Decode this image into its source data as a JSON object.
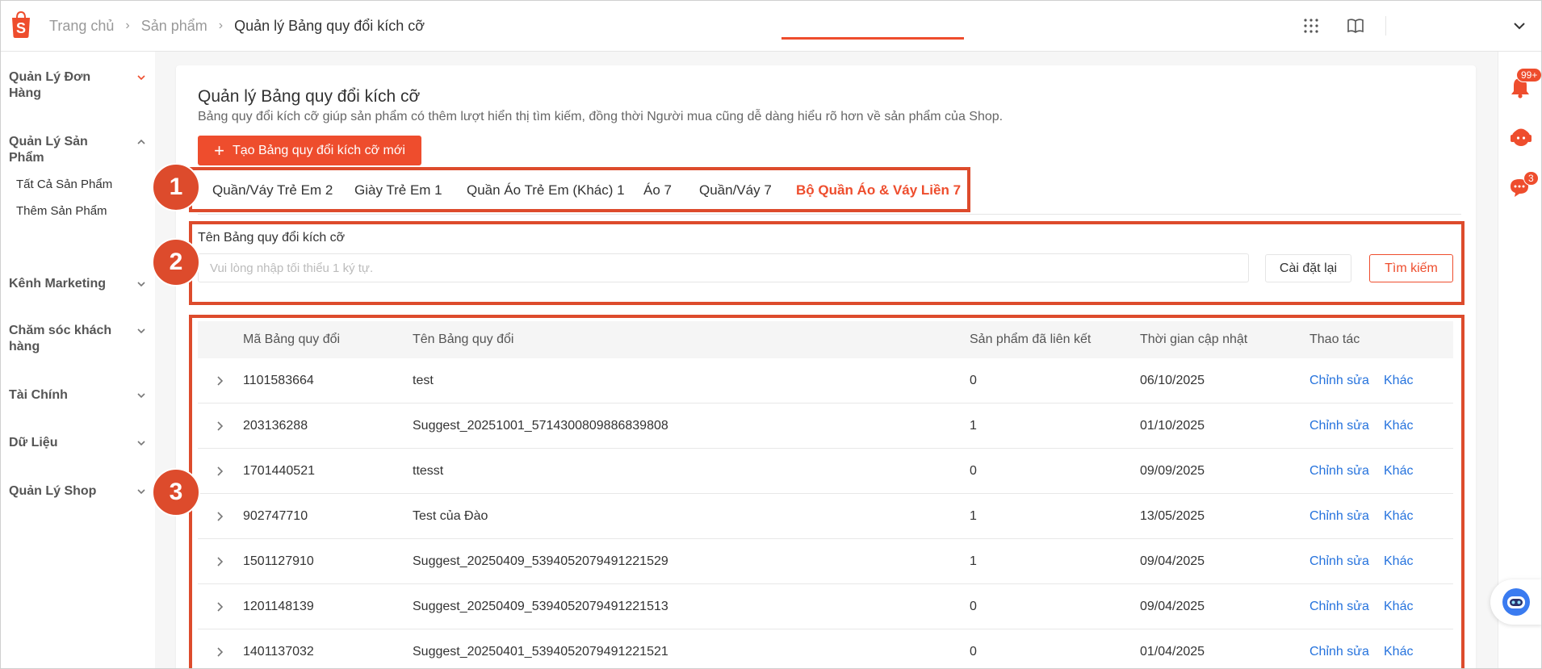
{
  "breadcrumb": {
    "home": "Trang chủ",
    "products": "Sản phẩm",
    "current": "Quản lý Bảng quy đổi kích cỡ"
  },
  "sidebar": {
    "groups": [
      {
        "label": "Quản Lý Đơn Hàng",
        "expanded": false
      },
      {
        "label": "Quản Lý Sản Phẩm",
        "expanded": true,
        "items": [
          "Tất Cả Sản Phẩm",
          "Thêm Sản Phẩm"
        ]
      },
      {
        "label": "Kênh Marketing",
        "expanded": false
      },
      {
        "label": "Chăm sóc khách hàng",
        "expanded": false
      },
      {
        "label": "Tài Chính",
        "expanded": false
      },
      {
        "label": "Dữ Liệu",
        "expanded": false
      },
      {
        "label": "Quản Lý Shop",
        "expanded": false
      }
    ]
  },
  "page": {
    "title": "Quản lý Bảng quy đổi kích cỡ",
    "subtitle": "Bảng quy đổi kích cỡ giúp sản phẩm có thêm lượt hiển thị tìm kiếm, đồng thời Người mua cũng dễ dàng hiểu rõ hơn về sản phẩm của Shop.",
    "create_button": "Tạo Bảng quy đổi kích cỡ mới"
  },
  "tabs": [
    {
      "label": "Quần/Váy Trẻ Em 2",
      "active": false
    },
    {
      "label": "Giày Trẻ Em 1",
      "active": false
    },
    {
      "label": "Quần Áo Trẻ Em (Khác) 1",
      "active": false
    },
    {
      "label": "Áo 7",
      "active": false
    },
    {
      "label": "Quần/Váy 7",
      "active": false
    },
    {
      "label": "Bộ Quần Áo & Váy Liền 7",
      "active": true
    }
  ],
  "search": {
    "label": "Tên Bảng quy đổi kích cỡ",
    "placeholder": "Vui lòng nhập tối thiểu 1 ký tự.",
    "value": "",
    "reset_button": "Cài đặt lại",
    "search_button": "Tìm kiếm"
  },
  "table": {
    "headers": [
      "Mã Bảng quy đổi",
      "Tên Bảng quy đổi",
      "Sản phẩm đã liên kết",
      "Thời gian cập nhật",
      "Thao tác"
    ],
    "edit_label": "Chỉnh sửa",
    "more_label": "Khác",
    "rows": [
      {
        "id": "1101583664",
        "name": "test",
        "linked": "0",
        "updated": "06/10/2025"
      },
      {
        "id": "203136288",
        "name": "Suggest_20251001_5714300809886839808",
        "linked": "1",
        "updated": "01/10/2025"
      },
      {
        "id": "1701440521",
        "name": "ttesst",
        "linked": "0",
        "updated": "09/09/2025"
      },
      {
        "id": "902747710",
        "name": "Test của Đào",
        "linked": "1",
        "updated": "13/05/2025"
      },
      {
        "id": "1501127910",
        "name": "Suggest_20250409_5394052079491221529",
        "linked": "1",
        "updated": "09/04/2025"
      },
      {
        "id": "1201148139",
        "name": "Suggest_20250409_5394052079491221513",
        "linked": "0",
        "updated": "09/04/2025"
      },
      {
        "id": "1401137032",
        "name": "Suggest_20250401_5394052079491221521",
        "linked": "0",
        "updated": "01/04/2025"
      }
    ]
  },
  "rail": {
    "notification_badge": "99+",
    "chat_badge": "3"
  },
  "annotations": [
    "1",
    "2",
    "3"
  ],
  "colors": {
    "accent": "#ee4d2d",
    "link": "#2673dd",
    "annotation": "#dd4b2c"
  }
}
